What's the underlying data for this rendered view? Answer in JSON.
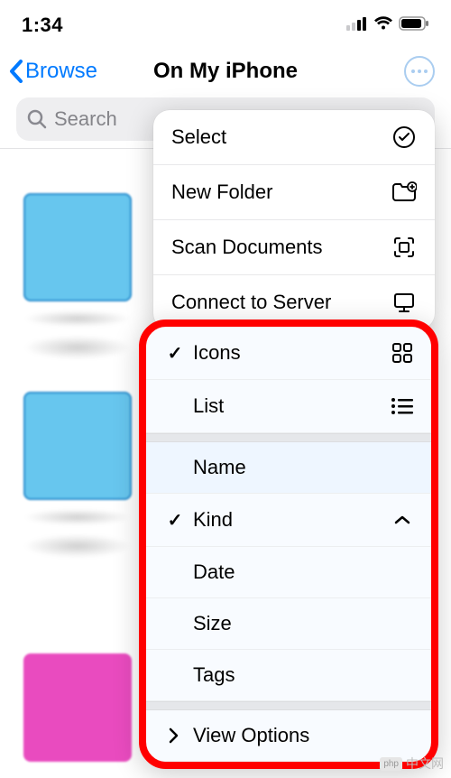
{
  "status": {
    "time": "1:34"
  },
  "nav": {
    "back_label": "Browse",
    "title": "On My iPhone"
  },
  "search": {
    "placeholder": "Search"
  },
  "menu_top": {
    "select": "Select",
    "new_folder": "New Folder",
    "scan_documents": "Scan Documents",
    "connect_server": "Connect to Server"
  },
  "menu_view": {
    "icons": {
      "label": "Icons",
      "checked": true
    },
    "list": {
      "label": "List",
      "checked": false
    }
  },
  "menu_sort": {
    "name": {
      "label": "Name",
      "checked": false
    },
    "kind": {
      "label": "Kind",
      "checked": true,
      "direction": "asc"
    },
    "date": {
      "label": "Date",
      "checked": false
    },
    "size": {
      "label": "Size",
      "checked": false
    },
    "tags": {
      "label": "Tags",
      "checked": false
    }
  },
  "menu_footer": {
    "view_options": "View Options"
  },
  "watermark": {
    "text": "中文网",
    "brand": "php"
  }
}
